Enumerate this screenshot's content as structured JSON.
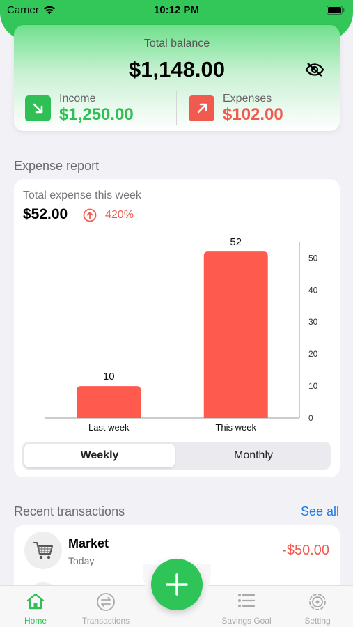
{
  "status_bar": {
    "carrier": "Carrier",
    "time": "10:12 PM"
  },
  "balance": {
    "label": "Total balance",
    "value": "$1,148.00",
    "income_label": "Income",
    "income_value": "$1,250.00",
    "expenses_label": "Expenses",
    "expenses_value": "$102.00"
  },
  "expense_report": {
    "title": "Expense report",
    "subtitle": "Total expense this week",
    "amount": "$52.00",
    "change_pct": "420%",
    "segments": {
      "weekly": "Weekly",
      "monthly": "Monthly",
      "selected": "Weekly"
    }
  },
  "chart_data": {
    "type": "bar",
    "categories": [
      "Last week",
      "This week"
    ],
    "values": [
      10,
      52
    ],
    "data_labels": [
      "10",
      "52"
    ],
    "ylim": [
      0,
      54
    ],
    "yticks": [
      0,
      10,
      20,
      30,
      40,
      50
    ],
    "y_axis_side": "right",
    "bar_color": "#ff5a4e",
    "title": "",
    "xlabel": "",
    "ylabel": ""
  },
  "recent": {
    "title": "Recent transactions",
    "see_all": "See all",
    "items": [
      {
        "name": "Market",
        "date": "Today",
        "amount": "-$50.00",
        "icon": "shopping-cart-icon"
      }
    ]
  },
  "tabs": [
    {
      "label": "Home",
      "icon": "home-icon",
      "active": true
    },
    {
      "label": "Transactions",
      "icon": "transfer-icon",
      "active": false
    },
    {
      "label": "Savings Goal",
      "icon": "list-icon",
      "active": false
    },
    {
      "label": "Setting",
      "icon": "gear-icon",
      "active": false
    }
  ],
  "colors": {
    "accent": "#2fbf55",
    "expense": "#f05a4f",
    "link": "#1e7ce6"
  }
}
